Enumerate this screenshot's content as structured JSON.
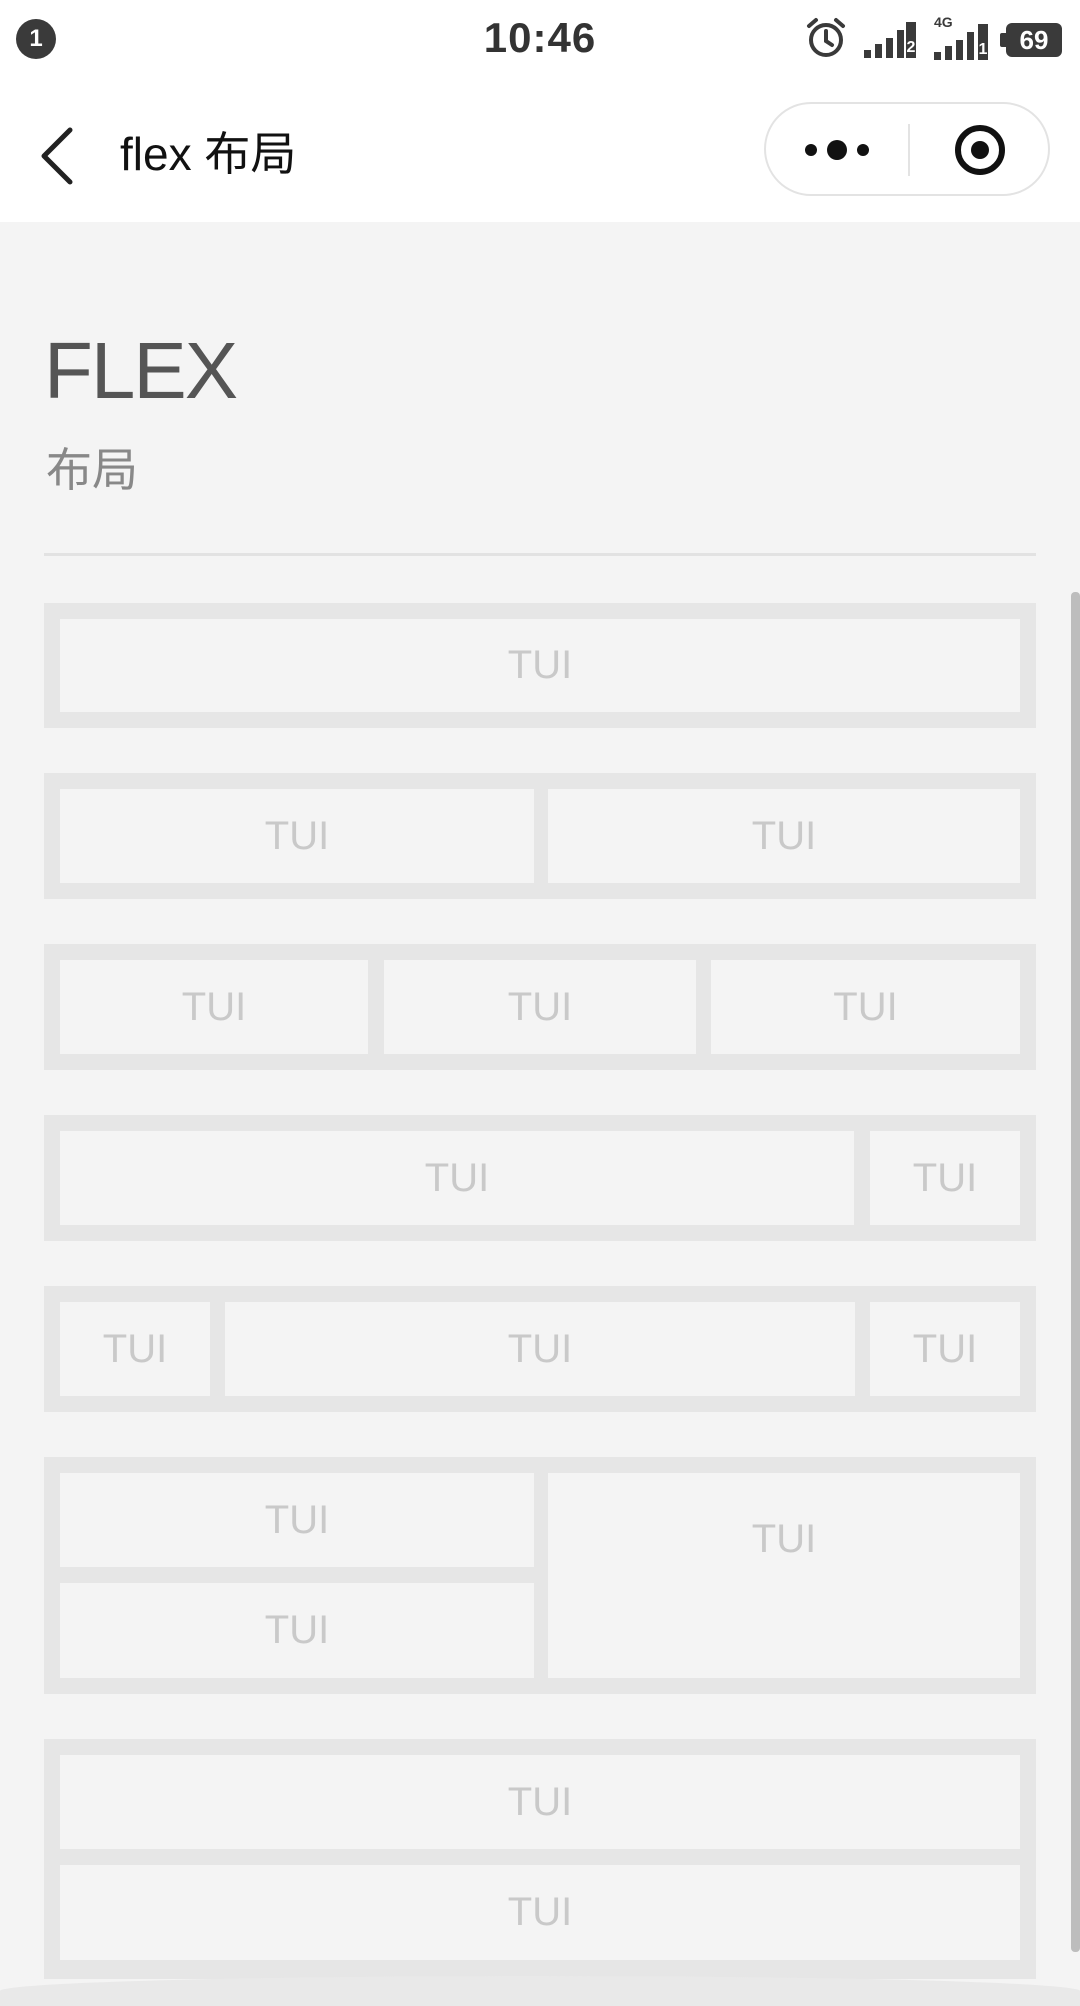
{
  "status_bar": {
    "notification_count": "1",
    "time": "10:46",
    "sim1_label": "2",
    "network_type": "4G",
    "sim2_label": "1",
    "battery": "69"
  },
  "nav": {
    "title": "flex 布局"
  },
  "header": {
    "title": "FLEX",
    "subtitle": "布局"
  },
  "cell_label": "TUI",
  "rows": [
    [
      "TUI"
    ],
    [
      "TUI",
      "TUI"
    ],
    [
      "TUI",
      "TUI",
      "TUI"
    ],
    [
      "TUI",
      "TUI"
    ],
    [
      "TUI",
      "TUI",
      "TUI"
    ],
    [
      "TUI",
      "TUI",
      "TUI"
    ],
    [
      "TUI",
      "TUI"
    ]
  ]
}
